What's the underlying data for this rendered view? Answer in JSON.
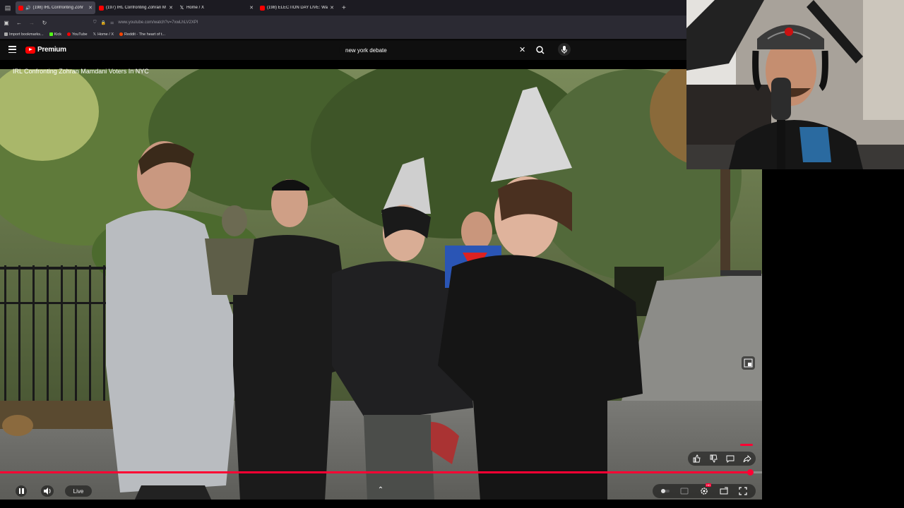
{
  "browser": {
    "tabs": [
      {
        "title": "(198) IRL Confronting Zohr",
        "favicon": "youtube",
        "active": true,
        "audio": true
      },
      {
        "title": "(197) IRL Confronting Zohran M",
        "favicon": "youtube",
        "active": false
      },
      {
        "title": "Home / X",
        "favicon": "x",
        "active": false
      },
      {
        "title": "(198) ELECTION DAY LIVE: Wat",
        "favicon": "youtube",
        "active": false
      }
    ],
    "new_tab_icon": "plus-icon",
    "url": "www.youtube.com/watch?v=7xwLhLV2XPI",
    "bookmarks": [
      {
        "label": "Import bookmarks..."
      },
      {
        "label": "Kick",
        "color": "#53fc18"
      },
      {
        "label": "YouTube",
        "color": "#ff0000"
      },
      {
        "label": "Home / X",
        "color": "#ffffff"
      },
      {
        "label": "Reddit - The heart of t...",
        "color": "#ff4500"
      }
    ]
  },
  "youtube": {
    "logo_text": "Premium",
    "search_value": "new york debate",
    "video_title": "IRL Confronting Zohran Mamdani Voters In NYC",
    "live_label": "Live",
    "hd_badge": "HD",
    "progress": 0.985,
    "accent": "#ff0033"
  }
}
